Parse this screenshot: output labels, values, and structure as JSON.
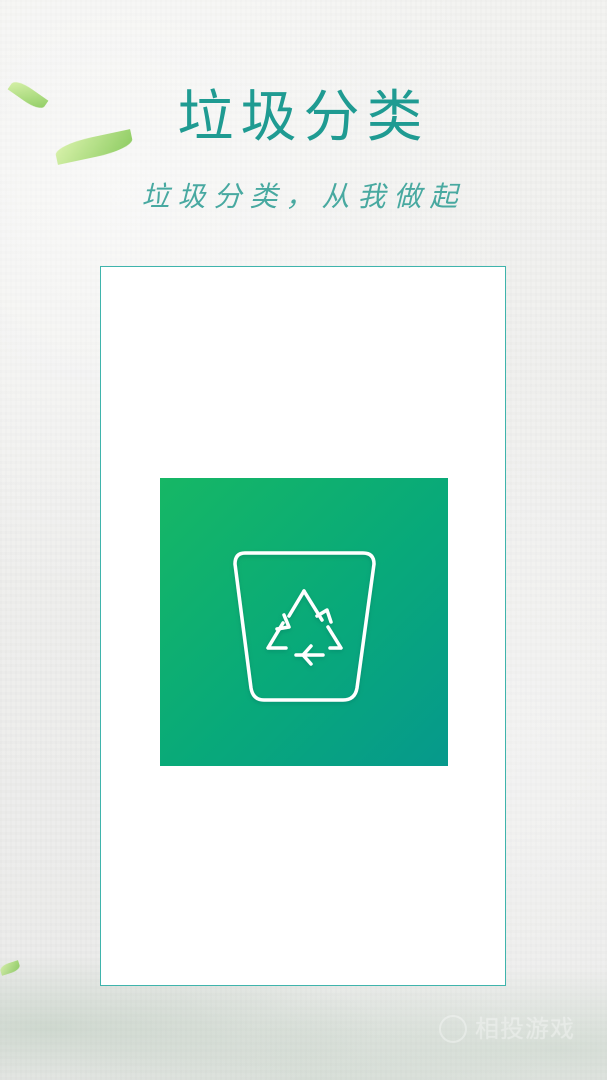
{
  "header": {
    "title": "垃圾分类",
    "subtitle": "垃圾分类，从我做起"
  },
  "decor": {
    "leaf_icon": "leaf-icon",
    "recycle_bin_icon": "recycle-bin-icon",
    "watermark_logo_icon": "watermark-logo-icon"
  },
  "colors": {
    "title": "#1f9b92",
    "subtitle": "#3aa39a",
    "frame_border": "#3fb4ac",
    "icon_gradient_start": "#16b765",
    "icon_gradient_end": "#06998c"
  },
  "watermark": {
    "text": "相投游戏"
  }
}
